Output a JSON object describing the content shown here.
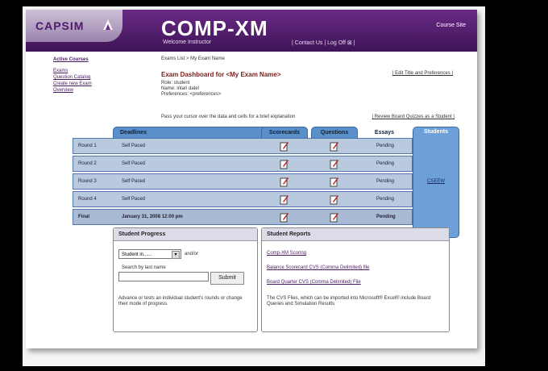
{
  "header": {
    "logo": "CAPSIM",
    "brand": "COMP-XM",
    "welcome": "Welcome Instructor",
    "signout": "| Contact Us | Log Off ⊠ |",
    "course_site": "Course Site"
  },
  "sidebar": {
    "active_courses": "Active Courses",
    "items": [
      "Exams",
      "Question Catalog",
      "Create new Exam",
      "Overview"
    ]
  },
  "breadcrumb": "Exams List > My Exam Name",
  "exam": {
    "title": "Exam Dashboard for <My Exam Name>",
    "meta": [
      "Role: student",
      "Name: intari date!",
      "Preferences: <preferences>"
    ],
    "edit_link": "| Edit Title and Preferences |"
  },
  "hover_note": "Pass your cursor over the data and cells for a brief explanation",
  "review_link": "| Review Board Quizzes as a Student |",
  "tabs": {
    "deadlines": "Deadlines",
    "scorecards": "Scorecards",
    "questions": "Questions",
    "essays": "Essays",
    "students": "Students"
  },
  "students_link": "CSEEW",
  "rows": [
    {
      "round": "Round 1",
      "deadline": "Self Paced",
      "essay": "Pending"
    },
    {
      "round": "Round 2",
      "deadline": "Self Paced",
      "essay": "Pending"
    },
    {
      "round": "Round 3",
      "deadline": "Self Paced",
      "essay": "Pending"
    },
    {
      "round": "Round 4",
      "deadline": "Self Paced",
      "essay": "Pending"
    },
    {
      "round": "Final",
      "deadline": "January 31, 2008 12:00 pm",
      "essay": "Pending"
    }
  ],
  "progress": {
    "title": "Student Progress",
    "select_value": "Student in......",
    "andor": "and/or",
    "search_label": "Search by last name",
    "submit": "Submit",
    "help": "Advance or tests an individual student's rounds or change their mode of progress."
  },
  "reports": {
    "title": "Student Reports",
    "links": [
      "Comp-XM Scoring",
      "Balance Scorecard CVS (Comma Delimited) file",
      "Board Quarter CVS (Comma Delimited) File"
    ],
    "note": "The CVS Files, which can be imported into Microsoft® Excel® include Board Queries and Simulation Results"
  }
}
